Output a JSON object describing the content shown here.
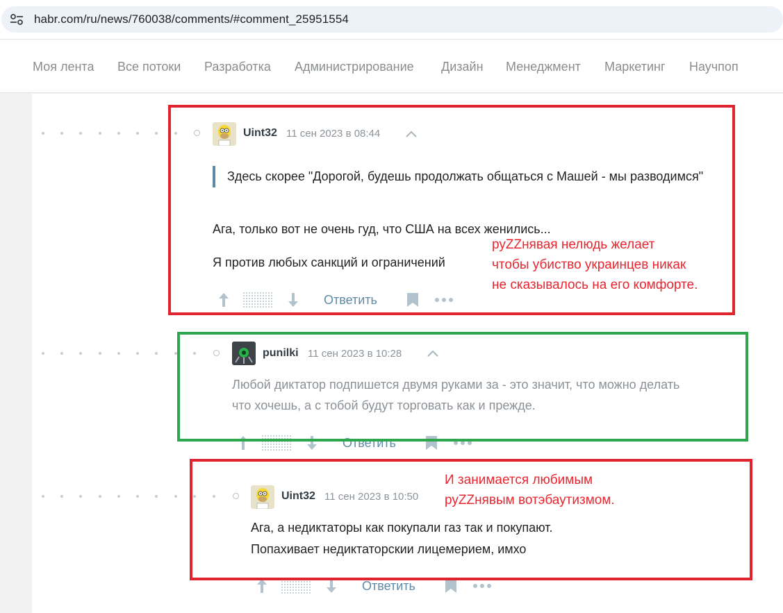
{
  "browser": {
    "url": "habr.com/ru/news/760038/comments/#comment_25951554"
  },
  "nav": {
    "items": [
      "Моя лента",
      "Все потоки",
      "Разработка",
      "Администрирование",
      "Дизайн",
      "Менеджмент",
      "Маркетинг",
      "Научпоп"
    ]
  },
  "comments": [
    {
      "username": "Uint32",
      "time": "11 сен 2023 в 08:44",
      "quote": "Здесь скорее \"Дорогой, будешь продолжать общаться с Машей - мы разводимся\"",
      "paragraphs": [
        "Ага, только вот не очень гуд, что США на всех женились...",
        "Я против любых санкций и ограничений"
      ],
      "reply_label": "Ответить"
    },
    {
      "username": "punilki",
      "time": "11 сен 2023 в 10:28",
      "paragraphs": [
        "Любой диктатор подпишется двумя руками за - это значит, что можно делать",
        "что хочешь, а с тобой будут торговать как и прежде."
      ],
      "reply_label": "Ответить"
    },
    {
      "username": "Uint32",
      "time": "11 сен 2023 в 10:50",
      "paragraphs": [
        "Ага, а недиктаторы как покупали газ так и покупают.",
        "Попахивает недиктаторскии лицемерием, имхо"
      ],
      "reply_label": "Ответить"
    }
  ],
  "annotations": [
    {
      "lines": [
        "руZZнявая нелюдь желает",
        "чтобы убиство украинцев никак",
        "не сказывалось на его комфорте."
      ]
    },
    {
      "lines": [
        "И занимается любимым",
        "руZZнявым вотэбаутизмом."
      ]
    }
  ],
  "colors": {
    "accent": "#5e8aa6",
    "highlight_red": "#e0242f",
    "highlight_green": "#2ea64d",
    "annotation": "#e8262f"
  },
  "icons": [
    "site-settings-icon",
    "chevron-up-icon",
    "arrow-up-icon",
    "arrow-down-icon",
    "bookmark-icon",
    "more-icon",
    "rating-placeholder-icon"
  ]
}
